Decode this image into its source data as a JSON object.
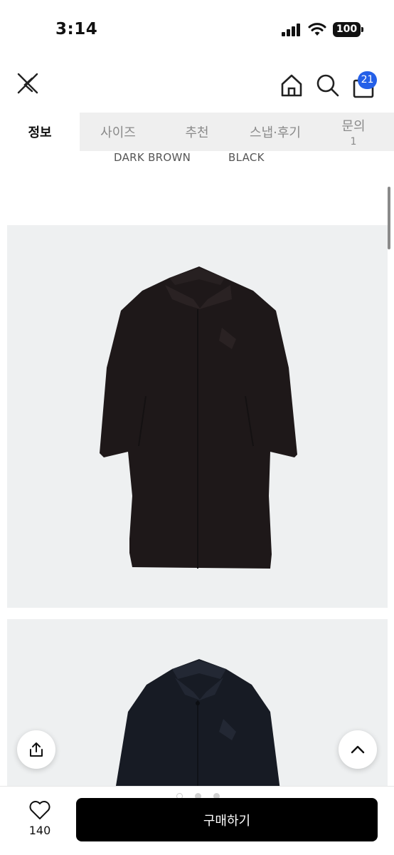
{
  "status": {
    "time": "3:14",
    "battery": "100"
  },
  "header": {
    "cart_count": "21"
  },
  "tabs": [
    {
      "label": "정보",
      "active": true
    },
    {
      "label": "사이즈"
    },
    {
      "label": "추천"
    },
    {
      "label": "스냅·후기"
    },
    {
      "label": "문의",
      "count": "1"
    }
  ],
  "colors": [
    "DARK BROWN",
    "BLACK"
  ],
  "footer": {
    "like_count": "140",
    "buy_label": "구매하기"
  },
  "carousel": {
    "total": 3,
    "active": 0
  },
  "icons": {
    "close": "close-icon",
    "home": "home-icon",
    "search": "search-icon",
    "cart": "shopping-bag-icon",
    "share": "share-icon",
    "scroll_top": "chevron-up-icon",
    "like": "heart-icon"
  }
}
